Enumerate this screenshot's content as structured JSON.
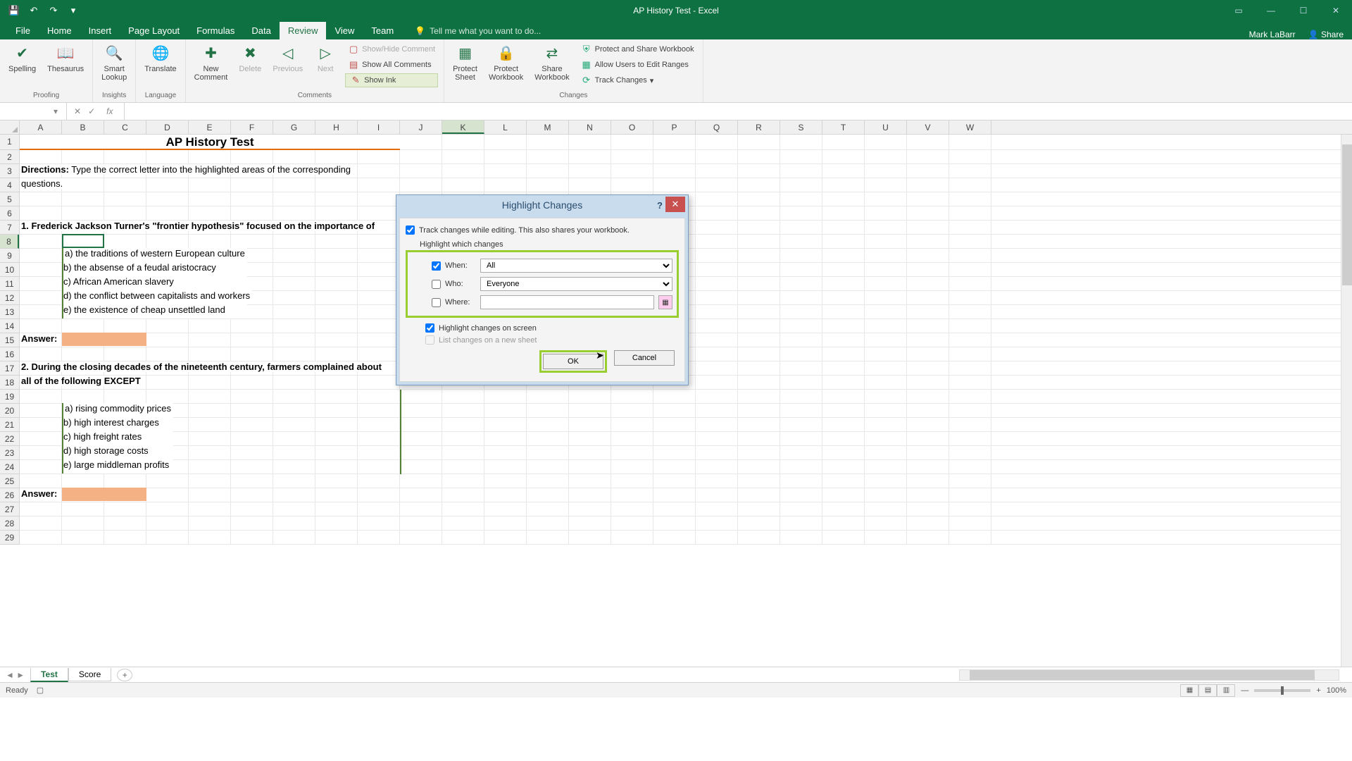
{
  "app": {
    "title": "AP History Test - Excel",
    "user": "Mark LaBarr",
    "share": "Share"
  },
  "tabs": [
    "File",
    "Home",
    "Insert",
    "Page Layout",
    "Formulas",
    "Data",
    "Review",
    "View",
    "Team"
  ],
  "active_tab": "Review",
  "tellme": "Tell me what you want to do...",
  "ribbon": {
    "proofing": {
      "spelling": "Spelling",
      "thesaurus": "Thesaurus",
      "label": "Proofing"
    },
    "insights": {
      "smart": "Smart\nLookup",
      "label": "Insights"
    },
    "language": {
      "translate": "Translate",
      "label": "Language"
    },
    "comments": {
      "new": "New\nComment",
      "delete": "Delete",
      "previous": "Previous",
      "next": "Next",
      "showhide": "Show/Hide Comment",
      "showall": "Show All Comments",
      "showink": "Show Ink",
      "label": "Comments"
    },
    "changes": {
      "sheet": "Protect\nSheet",
      "workbook": "Protect\nWorkbook",
      "shareWb": "Share\nWorkbook",
      "protectShare": "Protect and Share Workbook",
      "allowEdit": "Allow Users to Edit Ranges",
      "track": "Track Changes",
      "label": "Changes"
    }
  },
  "namebox": "",
  "columns": [
    "A",
    "B",
    "C",
    "D",
    "E",
    "F",
    "G",
    "H",
    "I",
    "J",
    "K",
    "L",
    "M",
    "N",
    "O",
    "P",
    "Q",
    "R",
    "S",
    "T",
    "U",
    "V",
    "W"
  ],
  "selected_col": "K",
  "selected_row": 8,
  "content": {
    "title": "AP History Test",
    "directions_label": "Directions:",
    "directions_text": "Type the correct letter into the highlighted areas of the corresponding",
    "directions_text2": "questions.",
    "q1": "1. Frederick Jackson Turner's \"frontier hypothesis\" focused on the importance of",
    "q1a": "a) the traditions of western European culture",
    "q1b": "b) the absense of a feudal aristocracy",
    "q1c": "c) African American slavery",
    "q1d": "d) the conflict between capitalists and workers",
    "q1e": "e) the existence of cheap unsettled land",
    "answer": "Answer:",
    "q2a_line1": "2. During the closing decades of the nineteenth century, farmers complained about",
    "q2a_line2": "all of the following EXCEPT",
    "q2a": "a) rising commodity prices",
    "q2b": "b) high interest charges",
    "q2c": "c) high freight rates",
    "q2d": "d) high storage costs",
    "q2e": "e) large middleman profits"
  },
  "sheets": {
    "tabs": [
      "Test",
      "Score"
    ],
    "active": "Test"
  },
  "status": {
    "ready": "Ready",
    "zoom": "100%"
  },
  "dialog": {
    "title": "Highlight Changes",
    "track": "Track changes while editing. This also shares your workbook.",
    "which": "Highlight which changes",
    "when": "When:",
    "when_val": "All",
    "who": "Who:",
    "who_val": "Everyone",
    "where": "Where:",
    "onscreen": "Highlight changes on screen",
    "newsheet": "List changes on a new sheet",
    "ok": "OK",
    "cancel": "Cancel"
  }
}
